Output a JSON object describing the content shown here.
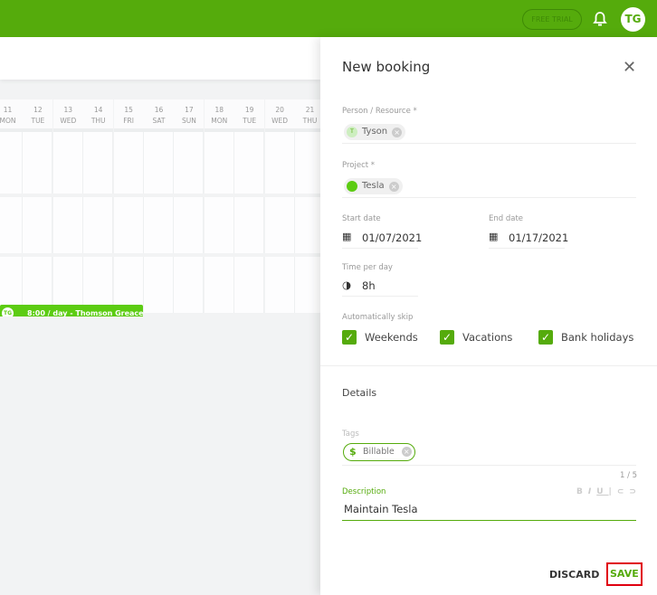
{
  "header": {
    "free_trial": "FREE TRIAL",
    "user_initials": "TG",
    "accent": "#55ab0c"
  },
  "calendar": {
    "days": [
      {
        "d": "11",
        "w": "MON"
      },
      {
        "d": "12",
        "w": "TUE"
      },
      {
        "d": "13",
        "w": "WED"
      },
      {
        "d": "14",
        "w": "THU"
      },
      {
        "d": "15",
        "w": "FRI"
      },
      {
        "d": "16",
        "w": "SAT"
      },
      {
        "d": "17",
        "w": "SUN"
      },
      {
        "d": "18",
        "w": "MON"
      },
      {
        "d": "19",
        "w": "TUE"
      },
      {
        "d": "20",
        "w": "WED"
      },
      {
        "d": "21",
        "w": "THU"
      }
    ],
    "booking": {
      "initials": "TG",
      "label": "8:00 / day - Thomson Greace"
    }
  },
  "panel": {
    "title": "New booking",
    "person_label": "Person / Resource *",
    "person_initial": "T",
    "person": "Tyson",
    "project_label": "Project *",
    "project": "Tesla",
    "start_label": "Start date",
    "start": "01/07/2021",
    "end_label": "End date",
    "end": "01/17/2021",
    "time_label": "Time per day",
    "time": "8h",
    "skip_label": "Automatically skip",
    "skip": [
      "Weekends",
      "Vacations",
      "Bank holidays"
    ],
    "details": "Details",
    "tags_label": "Tags",
    "tag": "Billable",
    "tag_count": "1 / 5",
    "desc_label": "Description",
    "desc": "Maintain Tesla",
    "discard": "DISCARD",
    "save": "SAVE"
  }
}
